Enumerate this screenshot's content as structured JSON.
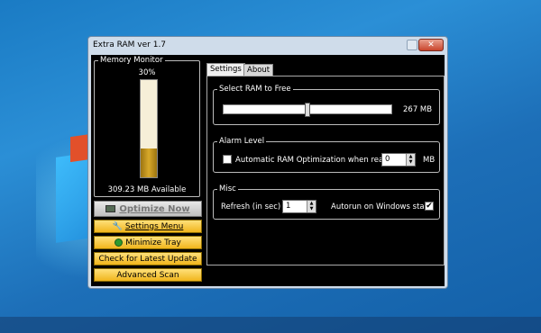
{
  "window": {
    "title": "Extra RAM ver 1.7",
    "close_label": "✕"
  },
  "memory_monitor": {
    "legend": "Memory Monitor",
    "usage_percent_label": "30%",
    "usage_fraction": 0.3,
    "available_text": "309.23 MB Available",
    "fill_color": "#d8a92a"
  },
  "buttons": {
    "optimize": "Optimize Now",
    "settings_menu": "Settings Menu",
    "minimize_tray": "Minimize Tray",
    "check_update": "Check for Latest Update",
    "advanced_scan": "Advanced Scan"
  },
  "tabs": [
    {
      "label": "Settings",
      "active": true
    },
    {
      "label": "About",
      "active": false
    }
  ],
  "settings": {
    "select_ram": {
      "legend": "Select RAM to Free",
      "slider_fraction": 0.5,
      "value_text": "267 MB"
    },
    "alarm": {
      "legend": "Alarm Level",
      "auto_opt_label": "Automatic RAM Optimization when reach",
      "auto_opt_checked": false,
      "level_value": "0",
      "unit": "MB"
    },
    "misc": {
      "legend": "Misc",
      "refresh_label": "Refresh (in sec)",
      "refresh_value": "1",
      "autorun_label": "Autorun on Windows start",
      "autorun_checked": true
    }
  },
  "colors": {
    "desktop": "#1d6fb8",
    "button_yellow": "#f0b51c",
    "client_bg": "#000000"
  },
  "icons": [
    "close-icon",
    "ram-chip-icon",
    "wrench-icon",
    "green-arrow-icon",
    "check-icon",
    "spin-up-icon",
    "spin-down-icon"
  ]
}
